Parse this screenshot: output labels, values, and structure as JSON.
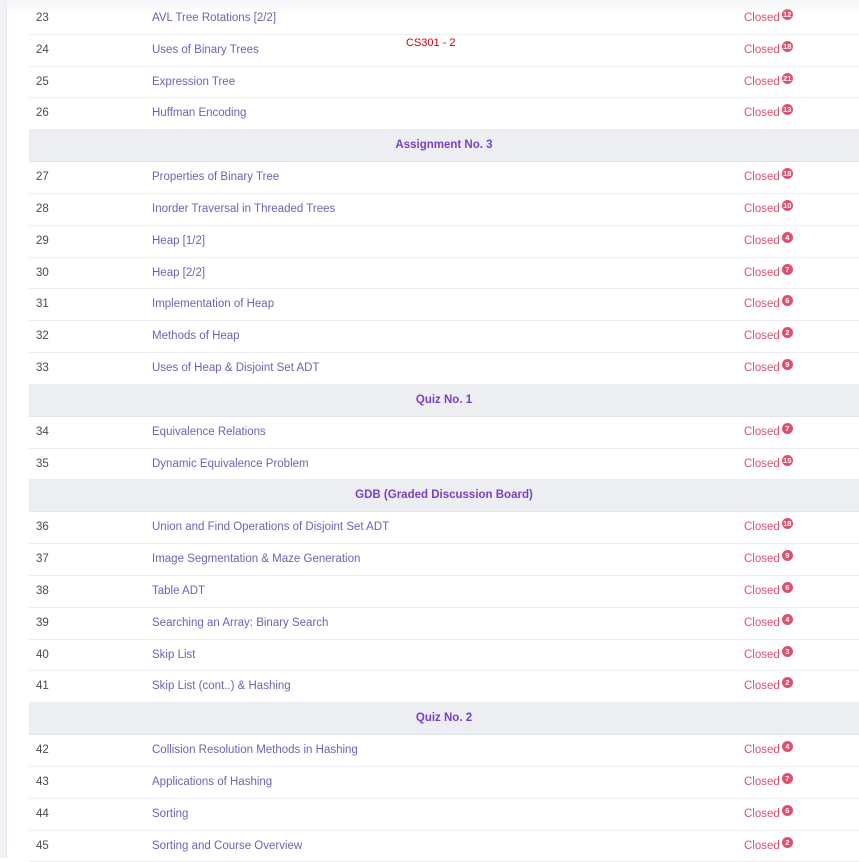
{
  "course_tag": "CS301 - 2",
  "accent_colors": {
    "topic_link": "#6b63b5",
    "status_closed": "#e0506e",
    "section_header": "#7b3fc4",
    "course_tag": "#cc0000"
  },
  "rows": [
    {
      "kind": "lesson",
      "num": "23",
      "topic": "AVL Tree Rotations [2/2]",
      "status": "Closed",
      "count": "12"
    },
    {
      "kind": "lesson",
      "num": "24",
      "topic": "Uses of Binary Trees",
      "status": "Closed",
      "count": "18"
    },
    {
      "kind": "lesson",
      "num": "25",
      "topic": "Expression Tree",
      "status": "Closed",
      "count": "21"
    },
    {
      "kind": "lesson",
      "num": "26",
      "topic": "Huffman Encoding",
      "status": "Closed",
      "count": "13"
    },
    {
      "kind": "section",
      "title": "Assignment No. 3"
    },
    {
      "kind": "lesson",
      "num": "27",
      "topic": "Properties of Binary Tree",
      "status": "Closed",
      "count": "18"
    },
    {
      "kind": "lesson",
      "num": "28",
      "topic": "Inorder Traversal in Threaded Trees",
      "status": "Closed",
      "count": "10"
    },
    {
      "kind": "lesson",
      "num": "29",
      "topic": "Heap [1/2]",
      "status": "Closed",
      "count": "4"
    },
    {
      "kind": "lesson",
      "num": "30",
      "topic": "Heap [2/2]",
      "status": "Closed",
      "count": "7"
    },
    {
      "kind": "lesson",
      "num": "31",
      "topic": "Implementation of Heap",
      "status": "Closed",
      "count": "6"
    },
    {
      "kind": "lesson",
      "num": "32",
      "topic": "Methods of Heap",
      "status": "Closed",
      "count": "2"
    },
    {
      "kind": "lesson",
      "num": "33",
      "topic": "Uses of Heap & Disjoint Set ADT",
      "status": "Closed",
      "count": "9"
    },
    {
      "kind": "section",
      "title": "Quiz No. 1"
    },
    {
      "kind": "lesson",
      "num": "34",
      "topic": "Equivalence Relations",
      "status": "Closed",
      "count": "7"
    },
    {
      "kind": "lesson",
      "num": "35",
      "topic": "Dynamic Equivalence Problem",
      "status": "Closed",
      "count": "15"
    },
    {
      "kind": "section",
      "title": "GDB (Graded Discussion Board)"
    },
    {
      "kind": "lesson",
      "num": "36",
      "topic": "Union and Find Operations of Disjoint Set ADT",
      "status": "Closed",
      "count": "18"
    },
    {
      "kind": "lesson",
      "num": "37",
      "topic": "Image Segmentation & Maze Generation",
      "status": "Closed",
      "count": "9"
    },
    {
      "kind": "lesson",
      "num": "38",
      "topic": "Table ADT",
      "status": "Closed",
      "count": "6"
    },
    {
      "kind": "lesson",
      "num": "39",
      "topic": "Searching an Array: Binary Search",
      "status": "Closed",
      "count": "4"
    },
    {
      "kind": "lesson",
      "num": "40",
      "topic": "Skip List",
      "status": "Closed",
      "count": "3"
    },
    {
      "kind": "lesson",
      "num": "41",
      "topic": "Skip List (cont..) & Hashing",
      "status": "Closed",
      "count": "2"
    },
    {
      "kind": "section",
      "title": "Quiz No. 2"
    },
    {
      "kind": "lesson",
      "num": "42",
      "topic": "Collision Resolution Methods in Hashing",
      "status": "Closed",
      "count": "4"
    },
    {
      "kind": "lesson",
      "num": "43",
      "topic": "Applications of Hashing",
      "status": "Closed",
      "count": "7"
    },
    {
      "kind": "lesson",
      "num": "44",
      "topic": "Sorting",
      "status": "Closed",
      "count": "6"
    },
    {
      "kind": "lesson",
      "num": "45",
      "topic": "Sorting and Course Overview",
      "status": "Closed",
      "count": "2"
    }
  ]
}
